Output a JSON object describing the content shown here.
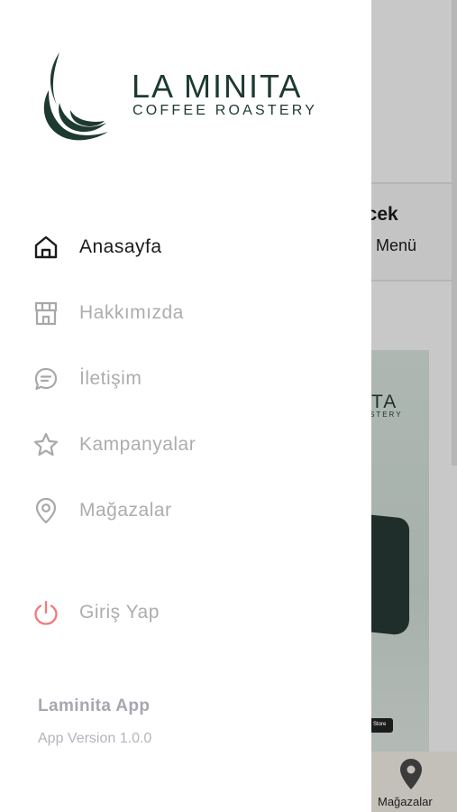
{
  "brand": {
    "name": "LA MINITA",
    "tagline": "COFFEE ROASTERY"
  },
  "menu": [
    {
      "label": "Anasayfa",
      "icon": "home-icon",
      "active": true
    },
    {
      "label": "Hakkımızda",
      "icon": "store-icon",
      "active": false
    },
    {
      "label": "İletişim",
      "icon": "chat-icon",
      "active": false
    },
    {
      "label": "Kampanyalar",
      "icon": "star-icon",
      "active": false
    },
    {
      "label": "Mağazalar",
      "icon": "location-pin-icon",
      "active": false
    }
  ],
  "login": {
    "label": "Giriş Yap",
    "icon": "power-icon",
    "color": "#f27b7b"
  },
  "footer": {
    "app_name": "Laminita App",
    "version": "App Version 1.0.0"
  },
  "background": {
    "section_title": "ecek",
    "menu_link": "Menü",
    "banner_logo": "TA",
    "banner_sub": "STERY",
    "store_badge": "Store",
    "bottom_nav_label": "Mağazalar"
  },
  "colors": {
    "brand_green": "#1d3a30",
    "active_text": "#1a1a1a",
    "inactive_text": "#adadad",
    "overlay": "#c8c8c8"
  }
}
